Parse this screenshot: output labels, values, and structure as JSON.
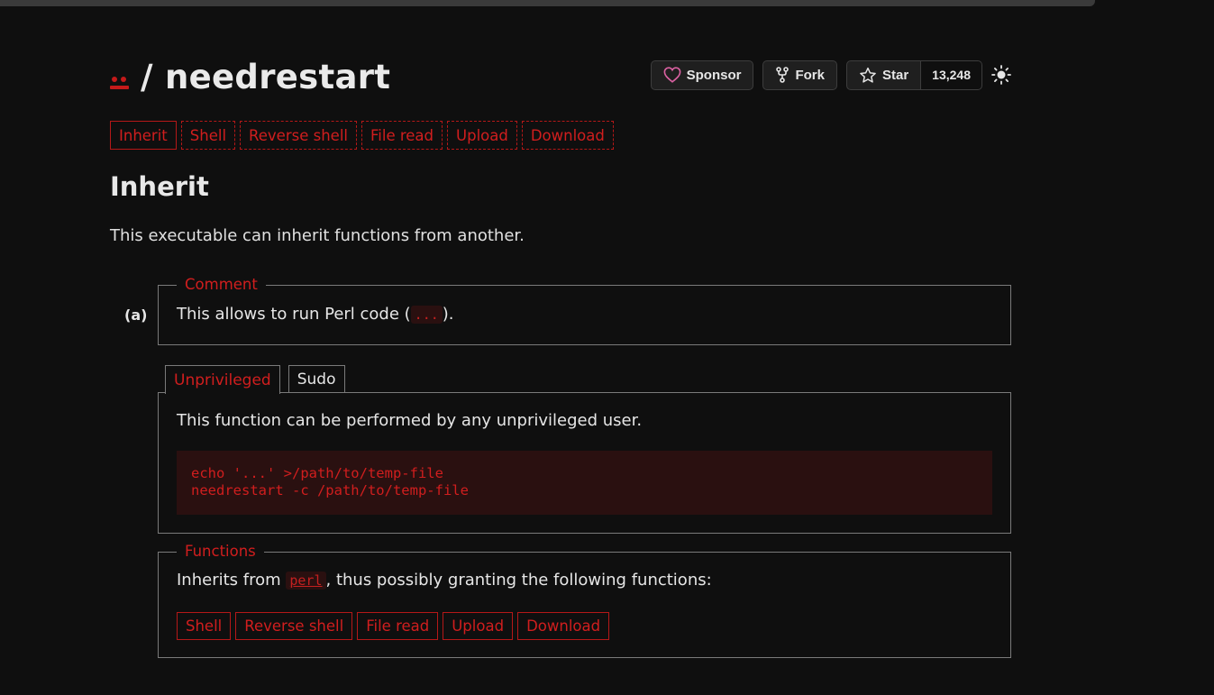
{
  "header": {
    "title": "/ needrestart",
    "sponsor_label": "Sponsor",
    "fork_label": "Fork",
    "star_label": "Star",
    "star_count": "13,248"
  },
  "function_tags": [
    "Inherit",
    "Shell",
    "Reverse shell",
    "File read",
    "Upload",
    "Download"
  ],
  "section": {
    "heading": "Inherit",
    "description": "This executable can inherit functions from another."
  },
  "entry": {
    "label": "(a)",
    "comment_legend": "Comment",
    "comment_prefix": "This allows to run Perl code (",
    "comment_code": "...",
    "comment_suffix": ")."
  },
  "tabs": [
    "Unprivileged",
    "Sudo"
  ],
  "unprivileged": {
    "description": "This function can be performed by any unprivileged user.",
    "code": "echo '...' >/path/to/temp-file\nneedrestart -c /path/to/temp-file"
  },
  "functions": {
    "legend": "Functions",
    "prefix": "Inherits from ",
    "link": "perl",
    "suffix": ", thus possibly granting the following functions:",
    "tags": [
      "Shell",
      "Reverse shell",
      "File read",
      "Upload",
      "Download"
    ]
  },
  "colors": {
    "accent": "#d11e1e",
    "background": "#0f0f0f",
    "code_bg": "#2a1010"
  }
}
